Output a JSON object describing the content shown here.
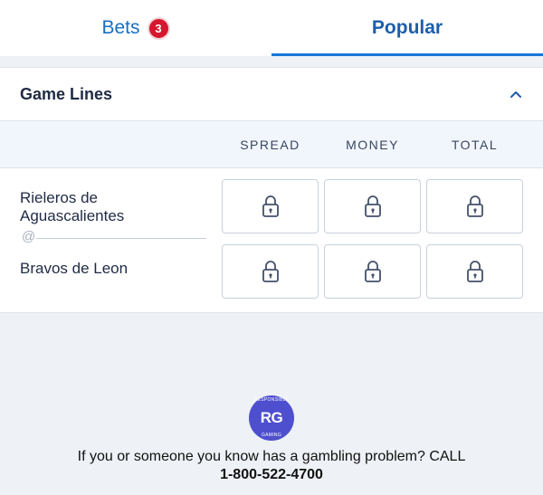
{
  "tabs": {
    "bets_label": "Bets",
    "bets_count": "3",
    "popular_label": "Popular"
  },
  "game_lines": {
    "title": "Game Lines",
    "columns": [
      "SPREAD",
      "MONEY",
      "TOTAL"
    ],
    "teams": {
      "away_line1": "Rieleros de",
      "away_line2": "Aguascalientes",
      "at_symbol": "@",
      "home": "Bravos de Leon"
    },
    "cells_state": "locked"
  },
  "footer": {
    "rg_logo": "RG",
    "rg_arc_top": "RESPONSIBLE",
    "rg_arc_bottom": "GAMING",
    "help_text": "If you or someone you know has a gambling problem? CALL",
    "phone": "1-800-522-4700"
  },
  "colors": {
    "accent": "#1878d8",
    "badge": "#d3182f",
    "rg_purple": "#4e4fcf"
  }
}
